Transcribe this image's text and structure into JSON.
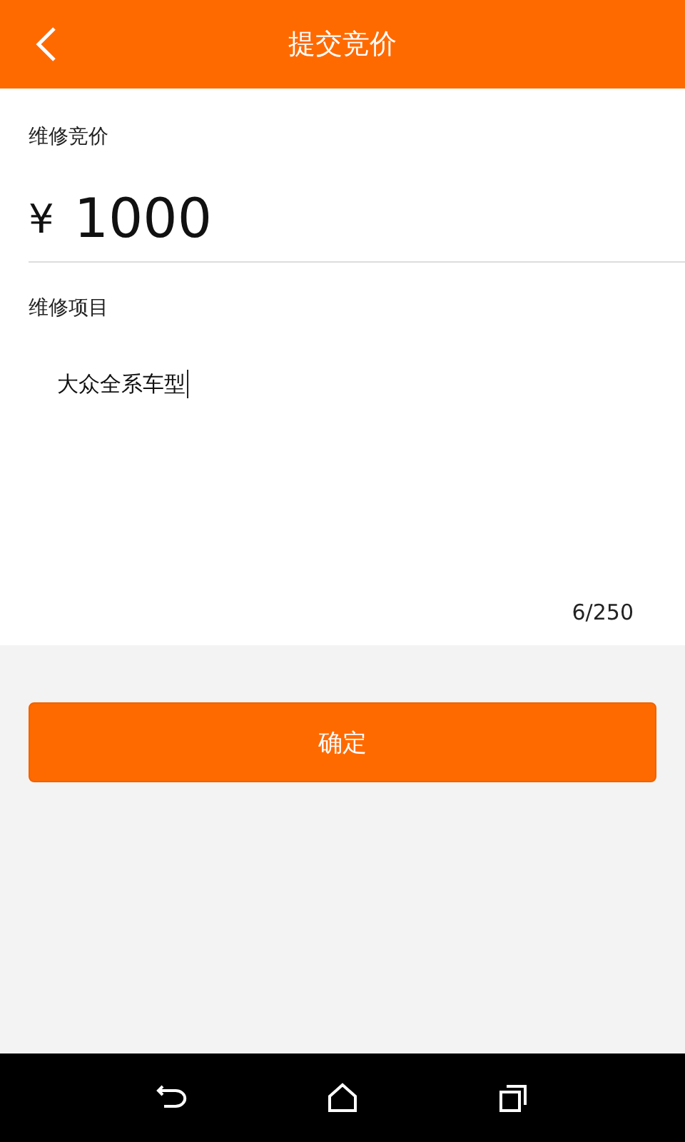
{
  "header": {
    "title": "提交竞价"
  },
  "price": {
    "label": "维修竞价",
    "currency": "¥",
    "value": "1000"
  },
  "items": {
    "label": "维修项目",
    "value": "大众全系车型",
    "focused": true,
    "counter": "6/250"
  },
  "confirm_button": "确定"
}
